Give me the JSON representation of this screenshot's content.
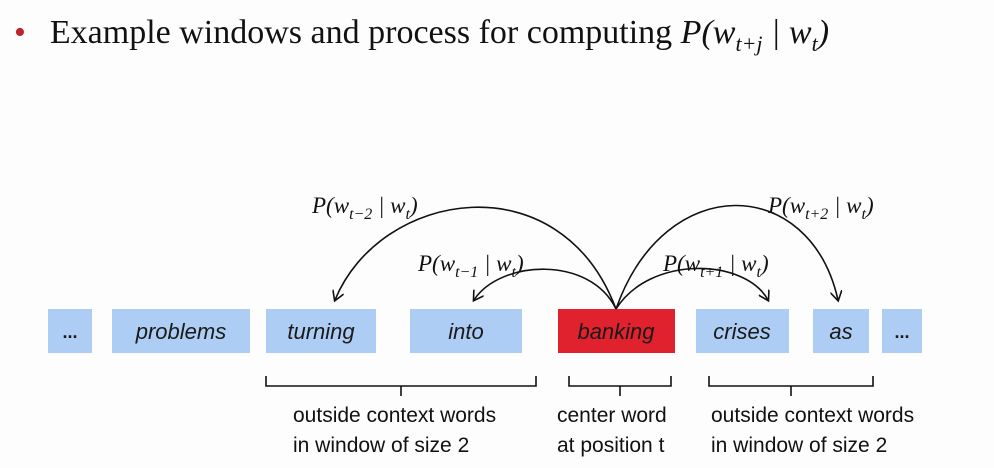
{
  "title": {
    "text": "Example windows and process for computing",
    "math": "P(w_{t+j} | w_t)"
  },
  "words": [
    "...",
    "problems",
    "turning",
    "into",
    "banking",
    "crises",
    "as",
    "..."
  ],
  "center_index": 4,
  "probabilities": {
    "t_minus_2": "P(w_{t−2} | w_t)",
    "t_minus_1": "P(w_{t−1} | w_t)",
    "t_plus_1": "P(w_{t+1} | w_t)",
    "t_plus_2": "P(w_{t+2} | w_t)"
  },
  "captions": {
    "left": [
      "outside context words",
      "in window of size 2"
    ],
    "center": [
      "center word",
      "at position t"
    ],
    "right": [
      "outside context words",
      "in window of size 2"
    ]
  },
  "colors": {
    "word_box": "#aecdf4",
    "center_box": "#e0222e",
    "bullet": "#c0242a"
  }
}
